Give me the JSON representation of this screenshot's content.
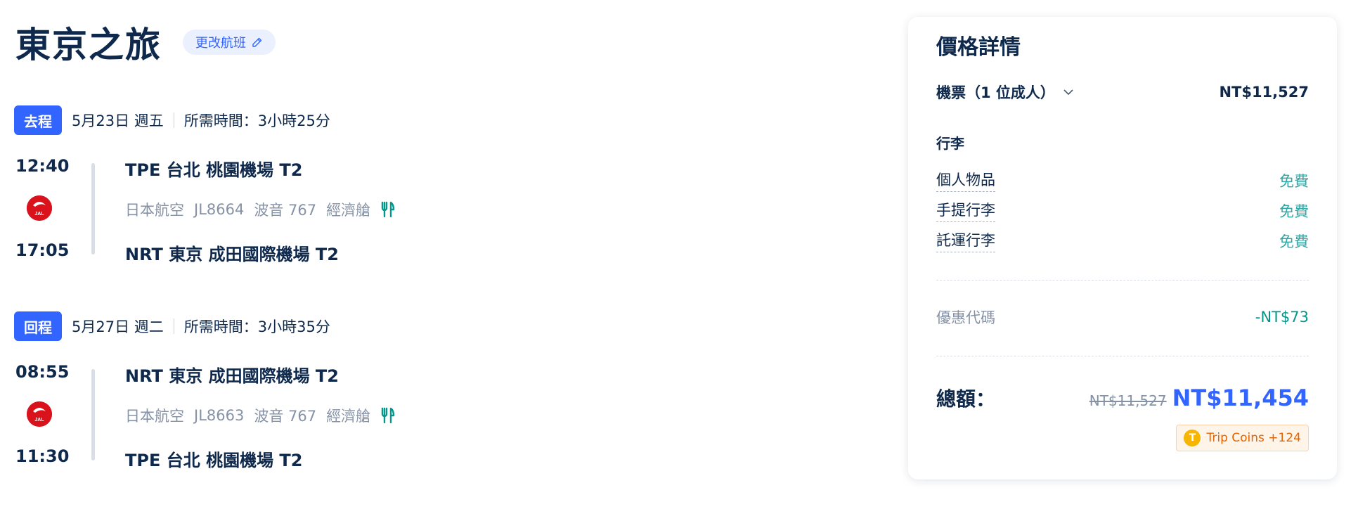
{
  "trip": {
    "title": "東京之旅",
    "change_flight_label": "更改航班"
  },
  "legs": [
    {
      "badge": "去程",
      "date": "5月23日 週五",
      "duration": "所需時間：3小時25分",
      "depart_time": "12:40",
      "arrive_time": "17:05",
      "depart_station": "TPE 台北 桃園機場 T2",
      "arrive_station": "NRT 東京 成田國際機場 T2",
      "airline": "日本航空",
      "flight_no": "JL8664",
      "aircraft": "波音 767",
      "cabin": "經濟艙",
      "logo_text": "JAL"
    },
    {
      "badge": "回程",
      "date": "5月27日 週二",
      "duration": "所需時間：3小時35分",
      "depart_time": "08:55",
      "arrive_time": "11:30",
      "depart_station": "NRT 東京 成田國際機場 T2",
      "arrive_station": "TPE 台北 桃園機場 T2",
      "airline": "日本航空",
      "flight_no": "JL8663",
      "aircraft": "波音 767",
      "cabin": "經濟艙",
      "logo_text": "JAL"
    }
  ],
  "price": {
    "title": "價格詳情",
    "ticket_label": "機票（1 位成人）",
    "ticket_price": "NT$11,527",
    "baggage_heading": "行李",
    "baggage": [
      {
        "name": "個人物品",
        "value": "免費"
      },
      {
        "name": "手提行李",
        "value": "免費"
      },
      {
        "name": "託運行李",
        "value": "免費"
      }
    ],
    "promo_label": "優惠代碼",
    "promo_value": "-NT$73",
    "total_label": "總額：",
    "original_total": "NT$11,527",
    "final_total": "NT$11,454",
    "coins_icon_text": "T",
    "coins_label": "Trip Coins +124"
  },
  "colors": {
    "primary": "#3264ff",
    "text": "#0f294d",
    "muted": "#8592a6",
    "free": "#2fa8a5",
    "promo": "#06958a",
    "airline_red": "#d9121b",
    "coins": "#e56300"
  },
  "icons": {
    "edit": "pencil-icon",
    "chevron": "chevron-down-icon",
    "meal": "meal-icon",
    "airline": "jal-logo-icon",
    "coin": "trip-coin-icon"
  }
}
